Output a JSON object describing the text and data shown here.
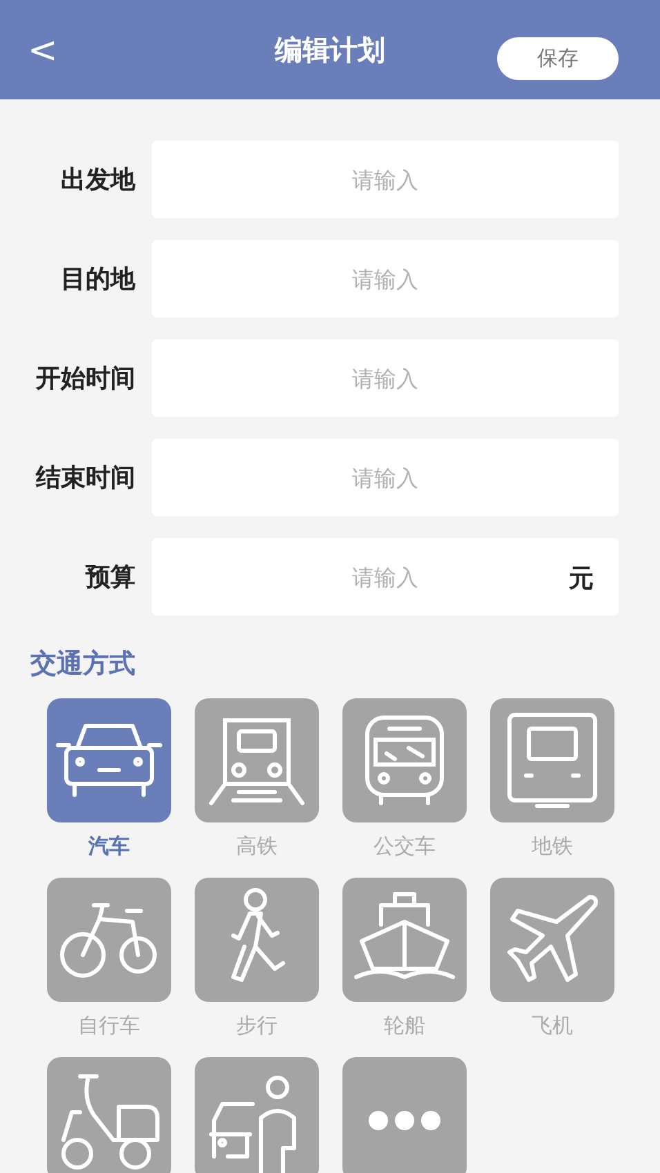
{
  "header": {
    "back": "<",
    "title": "编辑计划",
    "save": "保存"
  },
  "fields": [
    {
      "label": "出发地",
      "placeholder": "请输入"
    },
    {
      "label": "目的地",
      "placeholder": "请输入"
    },
    {
      "label": "开始时间",
      "placeholder": "请输入"
    },
    {
      "label": "结束时间",
      "placeholder": "请输入"
    },
    {
      "label": "预算",
      "placeholder": "请输入",
      "unit": "元"
    }
  ],
  "transport": {
    "title": "交通方式",
    "modes": [
      {
        "kind": "car",
        "label": "汽车",
        "selected": true
      },
      {
        "kind": "train",
        "label": "高铁",
        "selected": false
      },
      {
        "kind": "bus",
        "label": "公交车",
        "selected": false
      },
      {
        "kind": "subway",
        "label": "地铁",
        "selected": false
      },
      {
        "kind": "bicycle",
        "label": "自行车",
        "selected": false
      },
      {
        "kind": "walk",
        "label": "步行",
        "selected": false
      },
      {
        "kind": "ship",
        "label": "轮船",
        "selected": false
      },
      {
        "kind": "plane",
        "label": "飞机",
        "selected": false
      },
      {
        "kind": "scooter",
        "selected": false
      },
      {
        "kind": "person-car",
        "selected": false
      },
      {
        "kind": "more",
        "selected": false
      }
    ]
  }
}
